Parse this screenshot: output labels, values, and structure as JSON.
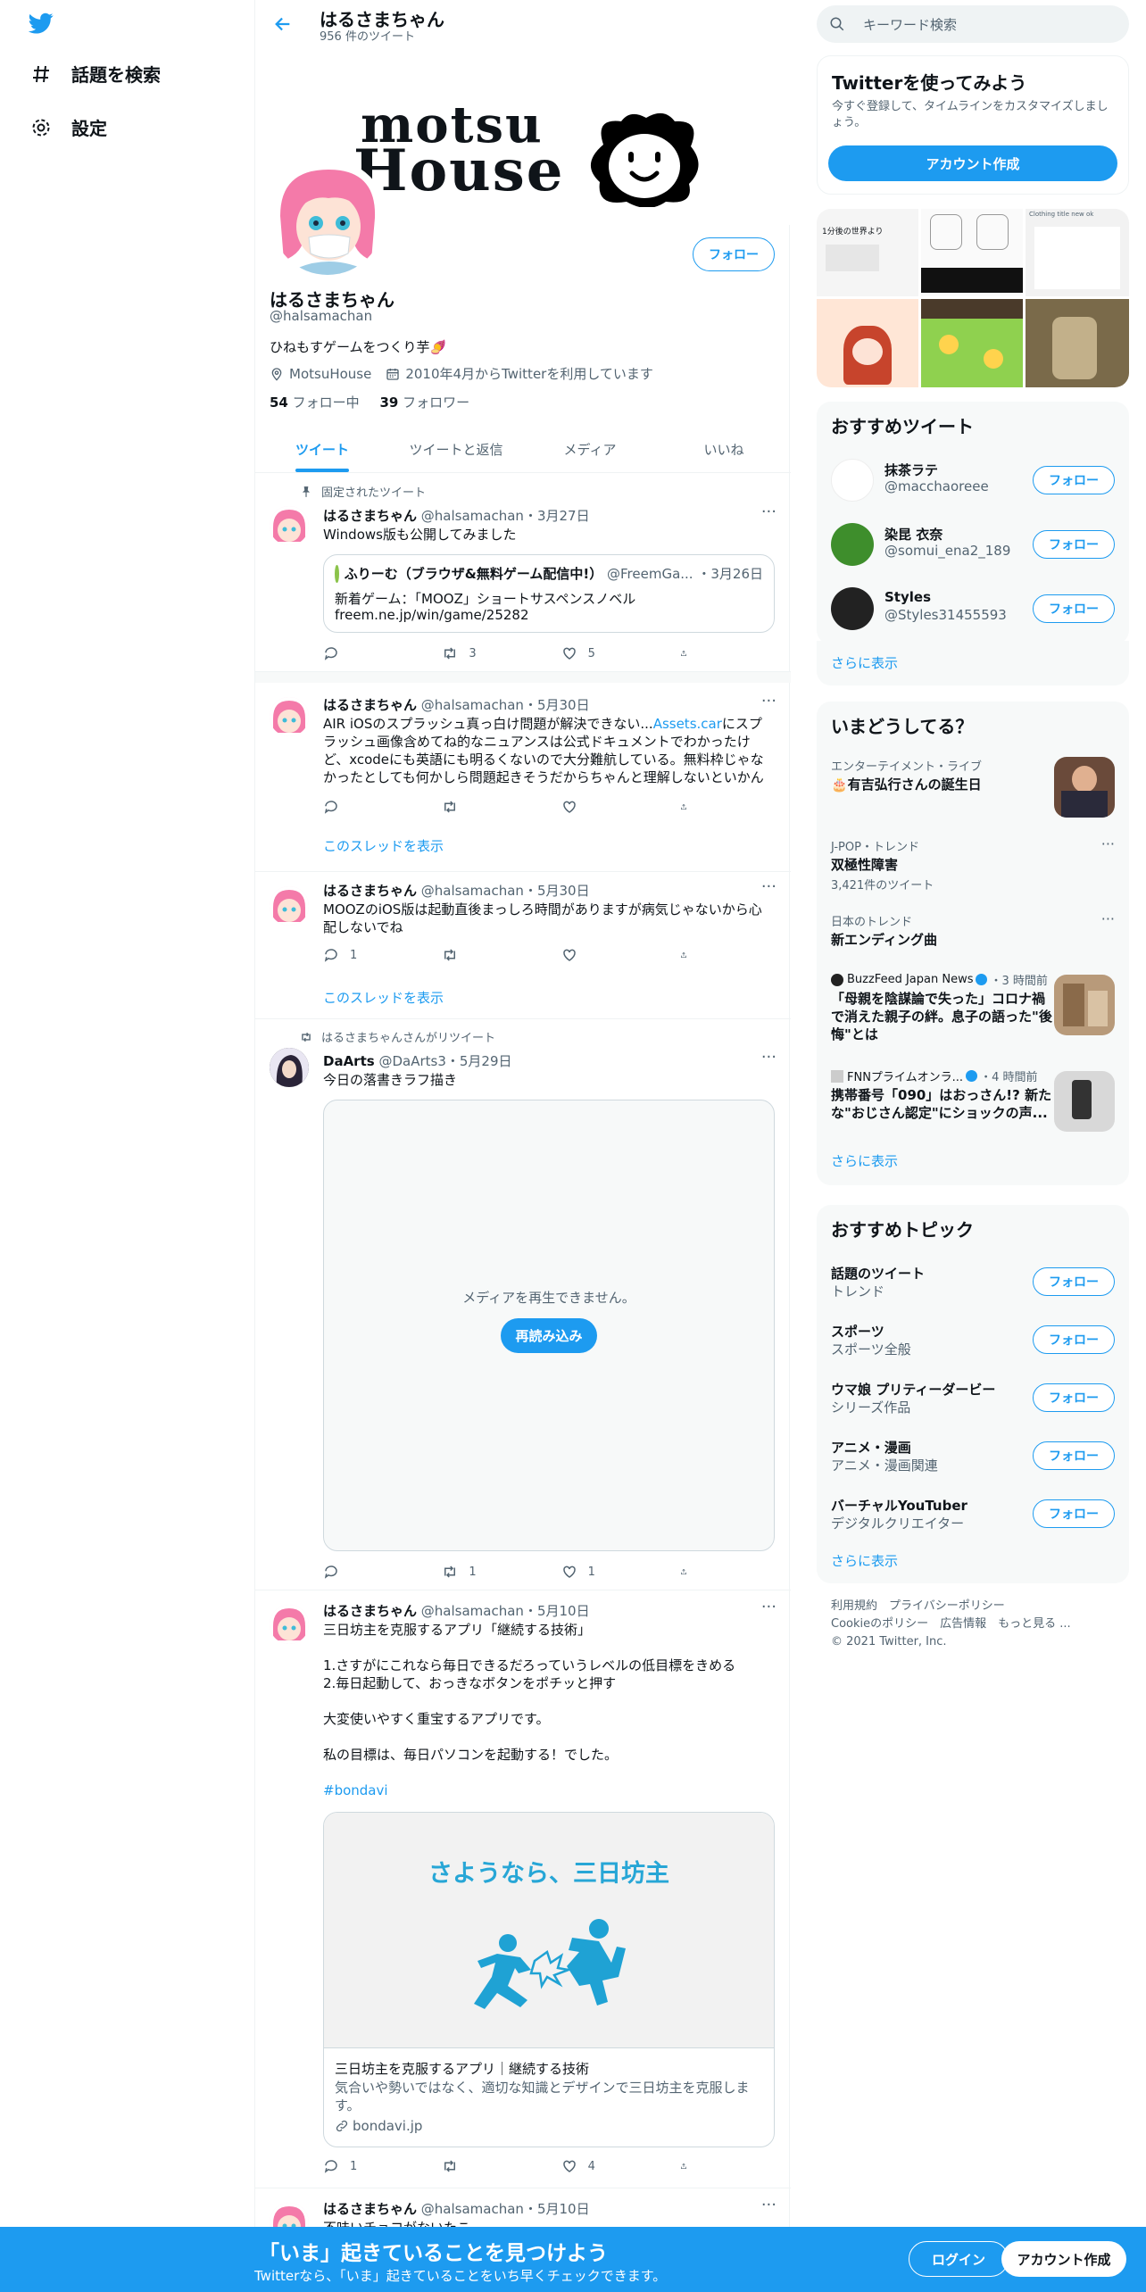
{
  "nav": {
    "explore": "話題を検索",
    "settings": "設定"
  },
  "header": {
    "name": "はるさまちゃん",
    "tweet_count": "956 件のツイート"
  },
  "banner": {
    "line1": "motsu",
    "line2": "House"
  },
  "profile": {
    "follow_label": "フォロー",
    "name": "はるさまちゃん",
    "handle": "@halsamachan",
    "bio": "ひねもすゲームをつくり芋🍠",
    "location": "MotsuHouse",
    "joined": "2010年4月からTwitterを利用しています",
    "following_count": "54",
    "following_label": "フォロー中",
    "followers_count": "39",
    "followers_label": "フォロワー"
  },
  "tabs": [
    "ツイート",
    "ツイートと返信",
    "メディア",
    "いいね"
  ],
  "tweets": [
    {
      "pinned": "固定されたツイート",
      "name": "はるさまちゃん",
      "handle": "@halsamachan",
      "date": "・3月27日",
      "text": "Windows版も公開してみました",
      "quote": {
        "name": "ふりーむ（ブラウザ&無料ゲーム配信中!）",
        "handle": "@FreemGa...",
        "date": "・3月26日",
        "text": "新着ゲーム：「MOOZ」ショートサスペンスノベル",
        "link": "freem.ne.jp/win/game/25282"
      },
      "reply": "",
      "retweet": "3",
      "like": "5"
    },
    {
      "name": "はるさまちゃん",
      "handle": "@halsamachan",
      "date": "・5月30日",
      "text_pre": "AIR iOSのスプラッシュ真っ白け問題が解決できない...",
      "text_link": "Assets.car",
      "text_post": "にスプラッシュ画像含めてね的なニュアンスは公式ドキュメントでわかったけど、xcodeにも英語にも明るくないので大分難航している。無料枠じゃなかったとしても何かしら問題起きそうだからちゃんと理解しないといかんよなぁ",
      "thread": "このスレッドを表示"
    },
    {
      "name": "はるさまちゃん",
      "handle": "@halsamachan",
      "date": "・5月30日",
      "text": "MOOZのiOS版は起動直後まっしろ時間がありますが病気じゃないから心配しないでね",
      "reply": "1",
      "thread": "このスレッドを表示"
    },
    {
      "rt_label": "はるさまちゃんさんがリツイート",
      "name": "DaArts",
      "handle": "@DaArts3",
      "date": "・5月29日",
      "text": "今日の落書きラフ描き",
      "media_error": "メディアを再生できません。",
      "reload": "再読み込み",
      "retweet": "1",
      "like": "1"
    },
    {
      "name": "はるさまちゃん",
      "handle": "@halsamachan",
      "date": "・5月10日",
      "text_lines": [
        "三日坊主を克服するアプリ「継続する技術」",
        "",
        "1.さすがにこれなら毎日できるだろっていうレベルの低目標をきめる",
        "2.毎日起動して、おっきなボタンをポチッと押す",
        "",
        "大変使いやすく重宝するアプリです。",
        "",
        "私の目標は、毎日パソコンを起動する！でした。",
        ""
      ],
      "hashtag": "#bondavi",
      "card": {
        "headline": "さようなら、三日坊主",
        "title": "三日坊主を克服するアプリ｜継続する技術",
        "desc": "気合いや勢いではなく、適切な知識とデザインで三日坊主を克服します。",
        "domain": "bondavi.jp"
      },
      "reply": "1",
      "like": "4"
    },
    {
      "name": "はるさまちゃん",
      "handle": "@halsamachan",
      "date": "・5月10日",
      "text": "不味いチョコがないたこ"
    }
  ],
  "search": {
    "placeholder": "キーワード検索"
  },
  "signup_panel": {
    "title": "Twitterを使ってみよう",
    "desc": "今すぐ登録して、タイムラインをカスタマイズしましょう。",
    "button": "アカウント作成"
  },
  "media_grid": {
    "cell0": "1分後の世界より",
    "cell2": "Clothing title new ok"
  },
  "recommended": {
    "title": "おすすめツイート",
    "users": [
      {
        "name": "抹茶ラテ",
        "handle": "@macchaoreee",
        "button": "フォロー"
      },
      {
        "name": "染昆 衣奈",
        "handle": "@somui_ena2_189",
        "button": "フォロー"
      },
      {
        "name": "Styles",
        "handle": "@Styles31455593",
        "button": "フォロー"
      }
    ],
    "more": "さらに表示"
  },
  "trends": {
    "title": "いまどうしてる？",
    "items": [
      {
        "cat": "エンターテイメント・ライブ",
        "title": "🎂有吉弘行さんの誕生日"
      },
      {
        "cat": "J-POP・トレンド",
        "title": "双極性障害",
        "count": "3,421件のツイート"
      },
      {
        "cat": "日本のトレンド",
        "title": "新エンディング曲"
      },
      {
        "cat": "BuzzFeed Japan News",
        "time": "・3 時間前",
        "title": "「母親を陰謀論で失った」コロナ禍で消えた親子の絆。息子の語った\"後悔\"とは"
      },
      {
        "cat": "FNNプライムオンラ...",
        "time": "・4 時間前",
        "title": "携帯番号「090」はおっさん!? 新たな\"おじさん認定\"にショックの声..."
      }
    ],
    "more": "さらに表示"
  },
  "topics": {
    "title": "おすすめトピック",
    "items": [
      {
        "name": "話題のツイート",
        "sub": "トレンド",
        "button": "フォロー"
      },
      {
        "name": "スポーツ",
        "sub": "スポーツ全般",
        "button": "フォロー"
      },
      {
        "name": "ウマ娘 プリティーダービー",
        "sub": "シリーズ作品",
        "button": "フォロー"
      },
      {
        "name": "アニメ・漫画",
        "sub": "アニメ・漫画関連",
        "button": "フォロー"
      },
      {
        "name": "バーチャルYouTuber",
        "sub": "デジタルクリエイター",
        "button": "フォロー"
      }
    ],
    "more": "さらに表示"
  },
  "footer": {
    "line1": "利用規約　プライバシーポリシー",
    "line2": "Cookieのポリシー　広告情報　もっと見る ...",
    "line3": "© 2021 Twitter, Inc."
  },
  "bottombar": {
    "title": "「いま」起きていることを見つけよう",
    "sub": "Twitterなら、「いま」起きていることをいち早くチェックできます。",
    "login": "ログイン",
    "signup": "アカウント作成"
  }
}
